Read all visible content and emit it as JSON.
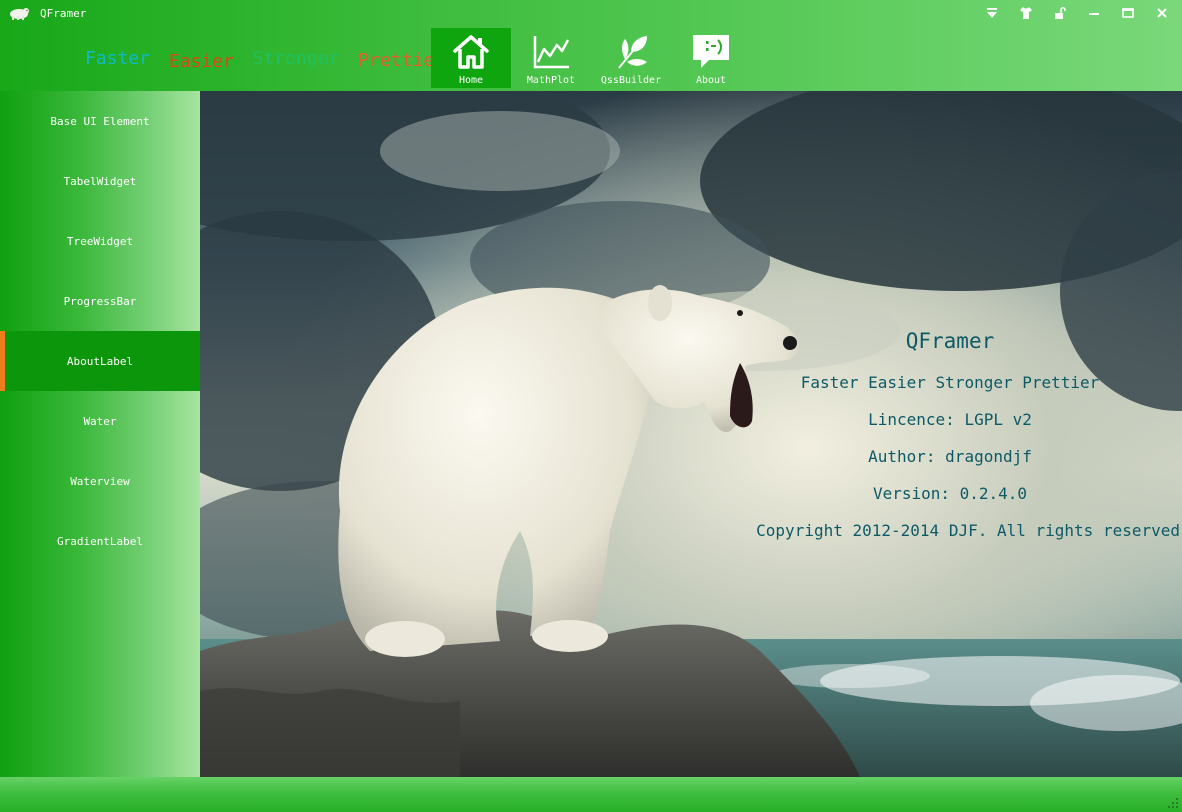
{
  "window": {
    "title": "QFramer",
    "controls": [
      {
        "icon": "dropdown-arrow-icon"
      },
      {
        "icon": "shirt-skin-icon"
      },
      {
        "icon": "unlock-icon"
      },
      {
        "icon": "minimize-icon"
      },
      {
        "icon": "maximize-icon"
      },
      {
        "icon": "close-icon"
      }
    ]
  },
  "slogan": {
    "words": [
      {
        "text": "Faster",
        "color": "#12b8c8"
      },
      {
        "text": "Easier",
        "color": "#d84a10"
      },
      {
        "text": "Stronger",
        "color": "#20c060"
      },
      {
        "text": "Prettier",
        "color": "#e0602a"
      }
    ]
  },
  "nav": {
    "items": [
      {
        "label": "Home",
        "icon": "home-icon",
        "active": true
      },
      {
        "label": "MathPlot",
        "icon": "line-chart-icon",
        "active": false
      },
      {
        "label": "QssBuilder",
        "icon": "leaf-icon",
        "active": false
      },
      {
        "label": "About",
        "icon": "smiley-chat-icon",
        "active": false
      }
    ]
  },
  "sidebar": {
    "items": [
      {
        "label": "Base UI Element"
      },
      {
        "label": "TabelWidget"
      },
      {
        "label": "TreeWidget"
      },
      {
        "label": "ProgressBar"
      },
      {
        "label": "AboutLabel",
        "active": true
      },
      {
        "label": "Water"
      },
      {
        "label": "Waterview"
      },
      {
        "label": "GradientLabel"
      }
    ]
  },
  "about": {
    "name": "QFramer",
    "slogan": "Faster Easier Stronger Prettier",
    "licence": "Lincence: LGPL v2",
    "author": "Author: dragondjf",
    "version": "Version: 0.2.4.0",
    "copyright": "Copyright 2012-2014 DJF. All rights reserved"
  },
  "colors": {
    "accent_green": "#0ea50e",
    "active_indicator": "#f07c1c",
    "about_text": "#0d5a66"
  }
}
